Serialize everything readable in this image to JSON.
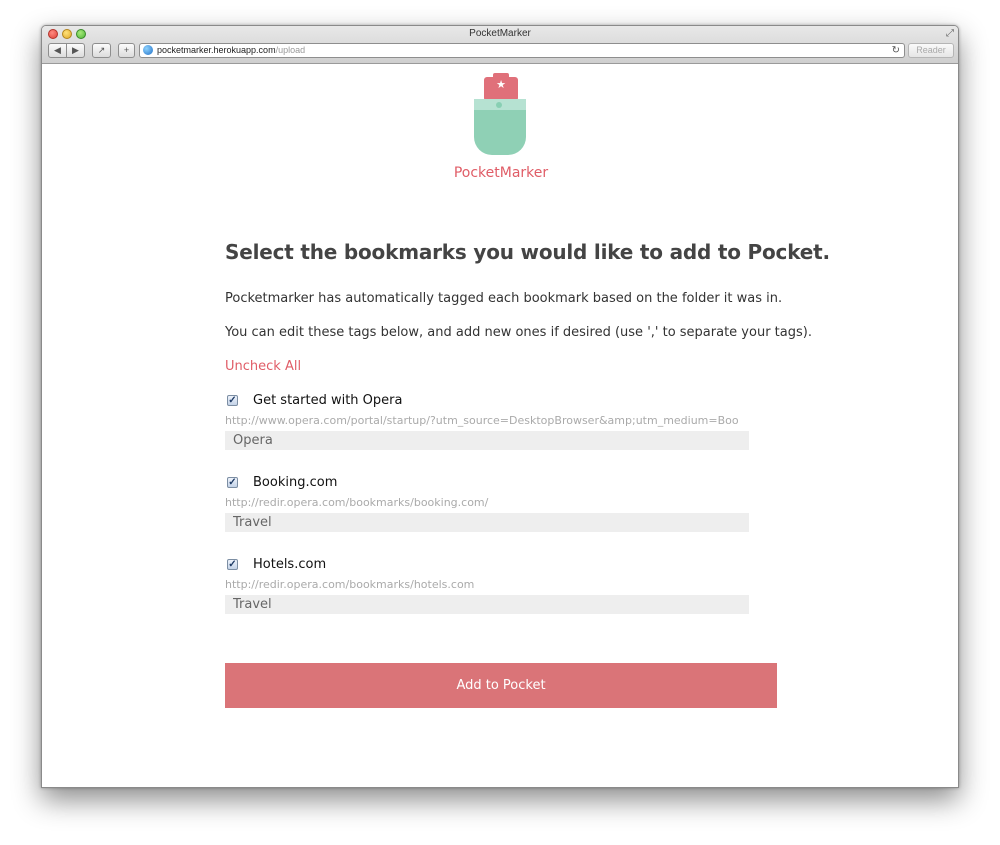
{
  "window": {
    "title": "PocketMarker",
    "url_host": "pocketmarker.herokuapp.com",
    "url_path": "/upload",
    "reader_label": "Reader"
  },
  "brand": {
    "name": "PocketMarker"
  },
  "page": {
    "heading": "Select the bookmarks you would like to add to Pocket.",
    "intro": "Pocketmarker has automatically tagged each bookmark based on the folder it was in.",
    "instructions": "You can edit these tags below, and add new ones if desired (use ',' to separate your tags).",
    "uncheck_all": "Uncheck All",
    "submit_label": "Add to Pocket"
  },
  "bookmarks": [
    {
      "checked": true,
      "title": "Get started with Opera",
      "url": "http://www.opera.com/portal/startup/?utm_source=DesktopBrowser&amp;utm_medium=Boo",
      "tags": "Opera"
    },
    {
      "checked": true,
      "title": "Booking.com",
      "url": "http://redir.opera.com/bookmarks/booking.com/",
      "tags": "Travel"
    },
    {
      "checked": true,
      "title": "Hotels.com",
      "url": "http://redir.opera.com/bookmarks/hotels.com",
      "tags": "Travel"
    }
  ],
  "colors": {
    "accent": "#e05d67",
    "button": "#da7478",
    "logo_mint": "#8fd0b5"
  }
}
